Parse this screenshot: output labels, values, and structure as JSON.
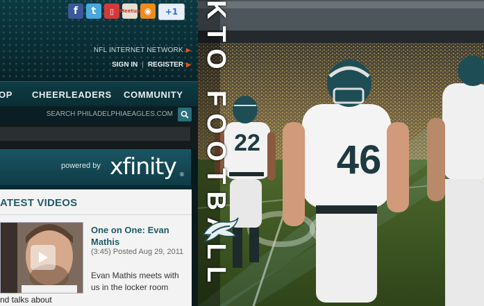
{
  "social": {
    "icons": [
      "facebook-icon",
      "twitter-icon",
      "phone-icon",
      "meetup-icon",
      "rss-icon",
      "google-plus-one-icon"
    ],
    "fb_glyph": "f",
    "tw_glyph": "t",
    "phone_glyph": "▯",
    "meetup_glyph": "Meetup",
    "rss_glyph": "◉",
    "gplus_label": "+1"
  },
  "header": {
    "nfl_link": "NFL INTERNET NETWORK",
    "sign_in": "SIGN IN",
    "separator": "|",
    "register": "REGISTER"
  },
  "nav": {
    "items": [
      {
        "label": "OP"
      },
      {
        "label": "CHEERLEADERS"
      },
      {
        "label": "COMMUNITY"
      }
    ]
  },
  "search": {
    "placeholder": "SEARCH PHILADELPHIAEAGLES.COM"
  },
  "sponsor": {
    "powered_by": "powered by",
    "brand": "xfinity",
    "reg": "®"
  },
  "videos": {
    "section_title": "ATEST VIDEOS",
    "item": {
      "title": "One on One: Evan Mathis",
      "meta": "(3:45) Posted Aug 29, 2011",
      "description": "Evan Mathis meets with us in the locker room"
    },
    "next_text": "nd talks about"
  },
  "hero": {
    "vertical_text": "KTO FOOTBALL",
    "jersey_left": "22",
    "jersey_center": "46"
  },
  "colors": {
    "accent": "#1e5a66",
    "arrow": "#e2541e",
    "header_bg": "#0a2c33"
  }
}
